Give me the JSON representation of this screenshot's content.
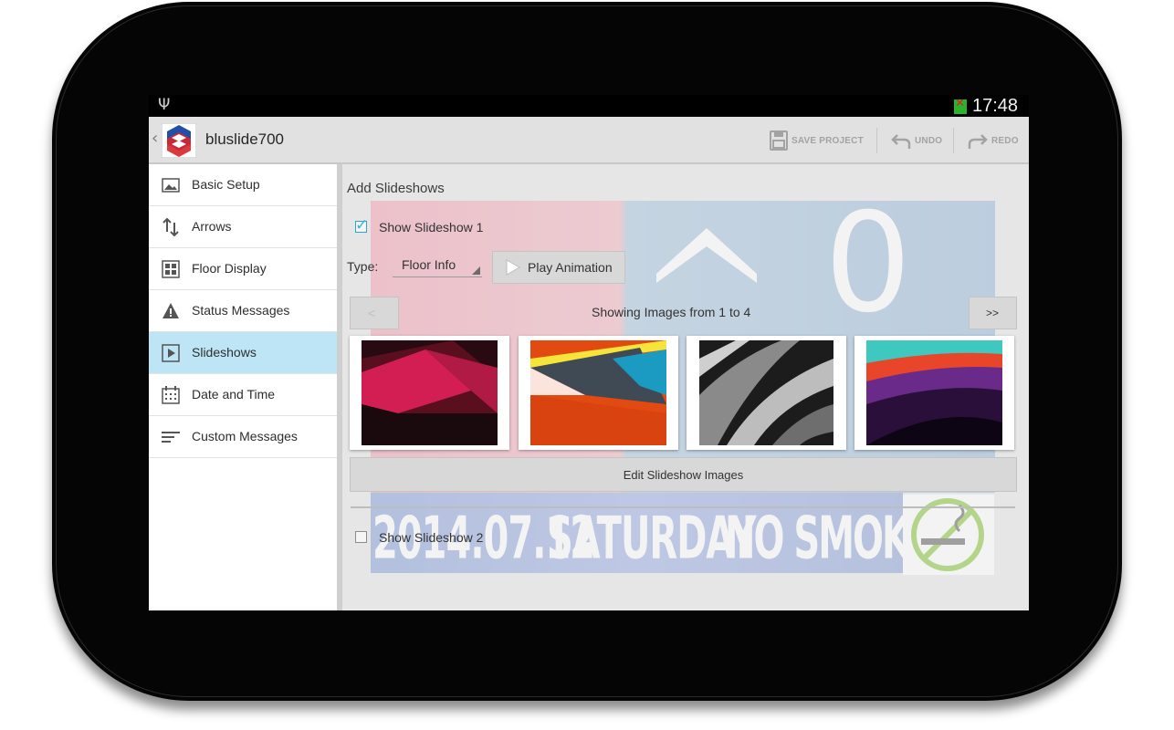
{
  "status_bar": {
    "time": "17:48",
    "usb_icon": "usb-icon",
    "battery_icon": "battery-alert-icon"
  },
  "app": {
    "title": "bluslide700"
  },
  "actions": {
    "save": "SAVE PROJECT",
    "undo": "UNDO",
    "redo": "REDO"
  },
  "sidebar": {
    "items": [
      {
        "label": "Basic Setup",
        "icon": "image-icon"
      },
      {
        "label": "Arrows",
        "icon": "arrows-updown-icon"
      },
      {
        "label": "Floor Display",
        "icon": "grid-icon"
      },
      {
        "label": "Status Messages",
        "icon": "warning-icon"
      },
      {
        "label": "Slideshows",
        "icon": "play-icon",
        "selected": true
      },
      {
        "label": "Date and Time",
        "icon": "calendar-icon"
      },
      {
        "label": "Custom Messages",
        "icon": "lines-icon"
      }
    ]
  },
  "main": {
    "section_title": "Add Slideshows",
    "slideshow1": {
      "label": "Show Slideshow 1",
      "checked": true
    },
    "type_label": "Type:",
    "type_value": "Floor Info",
    "play_button": "Play Animation",
    "pager": {
      "prev": "<",
      "text": "Showing Images from 1 to 4",
      "next": ">>"
    },
    "edit_button": "Edit Slideshow Images",
    "slideshow2": {
      "label": "Show Slideshow 2",
      "checked": false
    }
  },
  "preview": {
    "floor_digit": "0",
    "date": "2014.07.12",
    "weekday": "SATURDAY",
    "message": "NO SMOKING"
  },
  "colors": {
    "accent": "#33b5e5",
    "selected_row": "#bde5f5"
  }
}
